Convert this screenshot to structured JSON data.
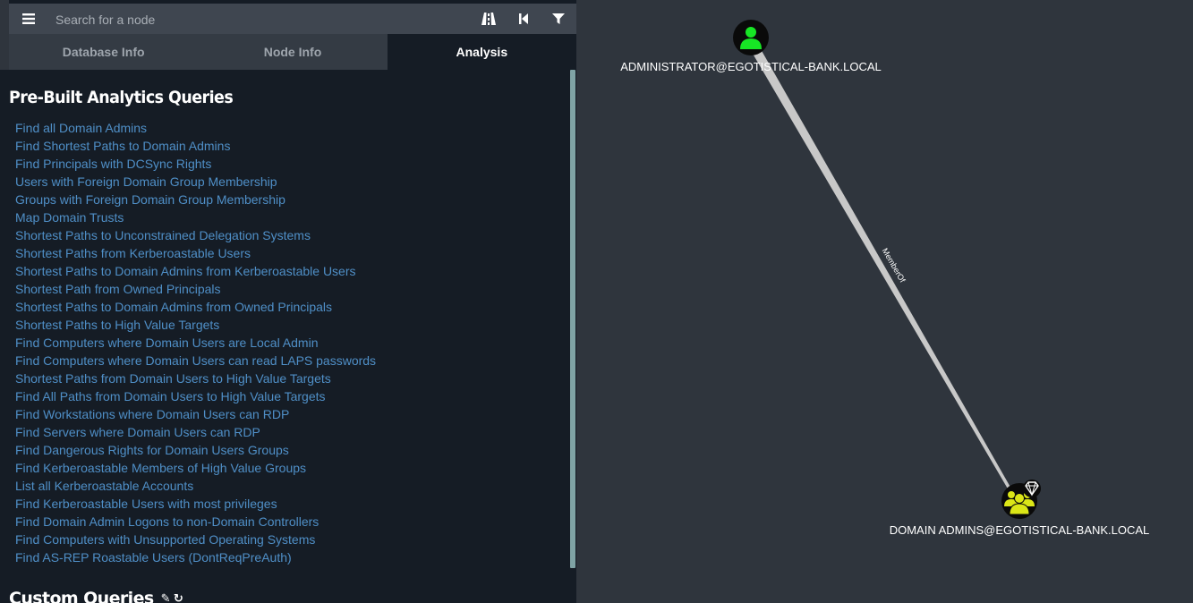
{
  "search": {
    "placeholder": "Search for a node"
  },
  "toolbar": {
    "menu_icon": "hamburger-menu-icon",
    "pathfinding_icon": "road-icon",
    "back_icon": "step-backward-icon",
    "filter_icon": "filter-icon"
  },
  "tabs": [
    {
      "label": "Database Info",
      "active": false
    },
    {
      "label": "Node Info",
      "active": false
    },
    {
      "label": "Analysis",
      "active": true
    }
  ],
  "analysis": {
    "prebuilt_heading": "Pre-Built Analytics Queries",
    "queries": [
      "Find all Domain Admins",
      "Find Shortest Paths to Domain Admins",
      "Find Principals with DCSync Rights",
      "Users with Foreign Domain Group Membership",
      "Groups with Foreign Domain Group Membership",
      "Map Domain Trusts",
      "Shortest Paths to Unconstrained Delegation Systems",
      "Shortest Paths from Kerberoastable Users",
      "Shortest Paths to Domain Admins from Kerberoastable Users",
      "Shortest Path from Owned Principals",
      "Shortest Paths to Domain Admins from Owned Principals",
      "Shortest Paths to High Value Targets",
      "Find Computers where Domain Users are Local Admin",
      "Find Computers where Domain Users can read LAPS passwords",
      "Shortest Paths from Domain Users to High Value Targets",
      "Find All Paths from Domain Users to High Value Targets",
      "Find Workstations where Domain Users can RDP",
      "Find Servers where Domain Users can RDP",
      "Find Dangerous Rights for Domain Users Groups",
      "Find Kerberoastable Members of High Value Groups",
      "List all Kerberoastable Accounts",
      "Find Kerberoastable Users with most privileges",
      "Find Domain Admin Logons to non-Domain Controllers",
      "Find Computers with Unsupported Operating Systems",
      "Find AS-REP Roastable Users (DontReqPreAuth)"
    ],
    "custom_heading": "Custom Queries"
  },
  "graph": {
    "nodes": [
      {
        "label": "ADMINISTRATOR@EGOTISTICAL-BANK.LOCAL",
        "type": "User",
        "color": "#17e625",
        "icon": "user-icon"
      },
      {
        "label": "DOMAIN ADMINS@EGOTISTICAL-BANK.LOCAL",
        "type": "Group",
        "color": "#dbe617",
        "icon": "group-icon",
        "high_value": true,
        "high_value_icon": "diamond-icon"
      }
    ],
    "edges": [
      {
        "label": "MemberOf",
        "from": 0,
        "to": 1
      }
    ]
  },
  "colors": {
    "canvas_bg": "#2f353d",
    "panel_bg": "#151c25",
    "link": "#4f8fc7",
    "edge": "#c8c8c8"
  }
}
